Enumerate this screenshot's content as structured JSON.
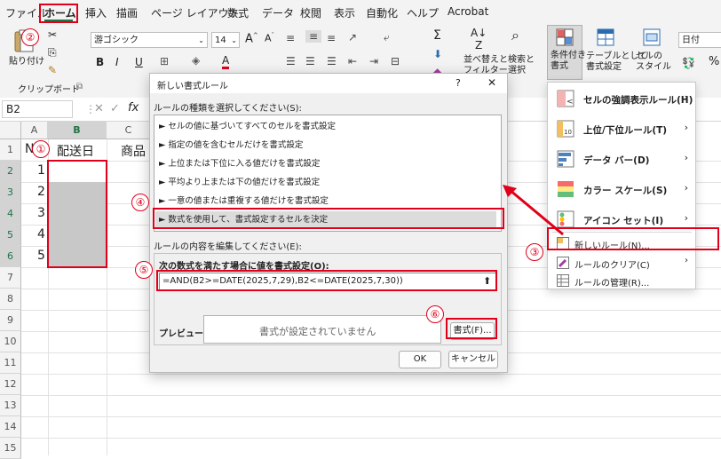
{
  "menu": {
    "tabs": [
      "ファイル",
      "ホーム",
      "挿入",
      "描画",
      "ページ レイアウト",
      "数式",
      "データ",
      "校閲",
      "表示",
      "自動化",
      "ヘルプ",
      "Acrobat"
    ],
    "active": "ホーム"
  },
  "ribbon": {
    "paste": "貼り付け",
    "clipboard": "クリップボード",
    "font_name": "游ゴシック",
    "font_size": "14",
    "bold": "B",
    "italic": "I",
    "underline": "U",
    "font_color": "A",
    "sort_filter": "並べ替えと\nフィルター",
    "find_select": "検索と\n選択",
    "cond_format": "条件付き\n書式",
    "table_format": "テーブルとして\n書式設定",
    "cell_style": "セルの\nスタイル",
    "number_format": "日付",
    "percent": "%"
  },
  "formula_bar": {
    "name_box": "B2",
    "fx": "fx"
  },
  "grid": {
    "columns": [
      "A",
      "B",
      "C"
    ],
    "rows": [
      "1",
      "2",
      "3",
      "4",
      "5",
      "6",
      "7",
      "8",
      "9",
      "10",
      "11",
      "12",
      "13",
      "14",
      "15"
    ],
    "a1": "N",
    "b1": "配送日",
    "c1": "商品",
    "a_values": [
      "1",
      "2",
      "3",
      "4",
      "5"
    ]
  },
  "dialog": {
    "title": "新しい書式ルール",
    "help": "?",
    "close": "✕",
    "rule_type_label": "ルールの種類を選択してください(S):",
    "rules": [
      "► セルの値に基づいてすべてのセルを書式設定",
      "► 指定の値を含むセルだけを書式設定",
      "► 上位または下位に入る値だけを書式設定",
      "► 平均より上または下の値だけを書式設定",
      "► 一意の値または重複する値だけを書式設定",
      "► 数式を使用して、書式設定するセルを決定"
    ],
    "edit_label": "ルールの内容を編集してください(E):",
    "formula_label": "次の数式を満たす場合に値を書式設定(O):",
    "formula": "=AND(B2>=DATE(2025,7,29),B2<=DATE(2025,7,30))",
    "preview_label": "プレビュー:",
    "preview_text": "書式が設定されていません",
    "format_button": "書式(F)...",
    "ok": "OK",
    "cancel": "キャンセル"
  },
  "cf_menu": {
    "items": [
      "セルの強調表示ルール(H)",
      "上位/下位ルール(T)",
      "データ バー(D)",
      "カラー スケール(S)",
      "アイコン セット(I)"
    ],
    "new_rule": "新しいルール(N)...",
    "clear_rules": "ルールのクリア(C)",
    "manage_rules": "ルールの管理(R)..."
  },
  "badges": [
    "①",
    "②",
    "③",
    "④",
    "⑤",
    "⑥"
  ],
  "colors": {
    "accent_red": "#e0001a",
    "excel_green": "#217346",
    "selected_gray": "#c8c8c8"
  }
}
